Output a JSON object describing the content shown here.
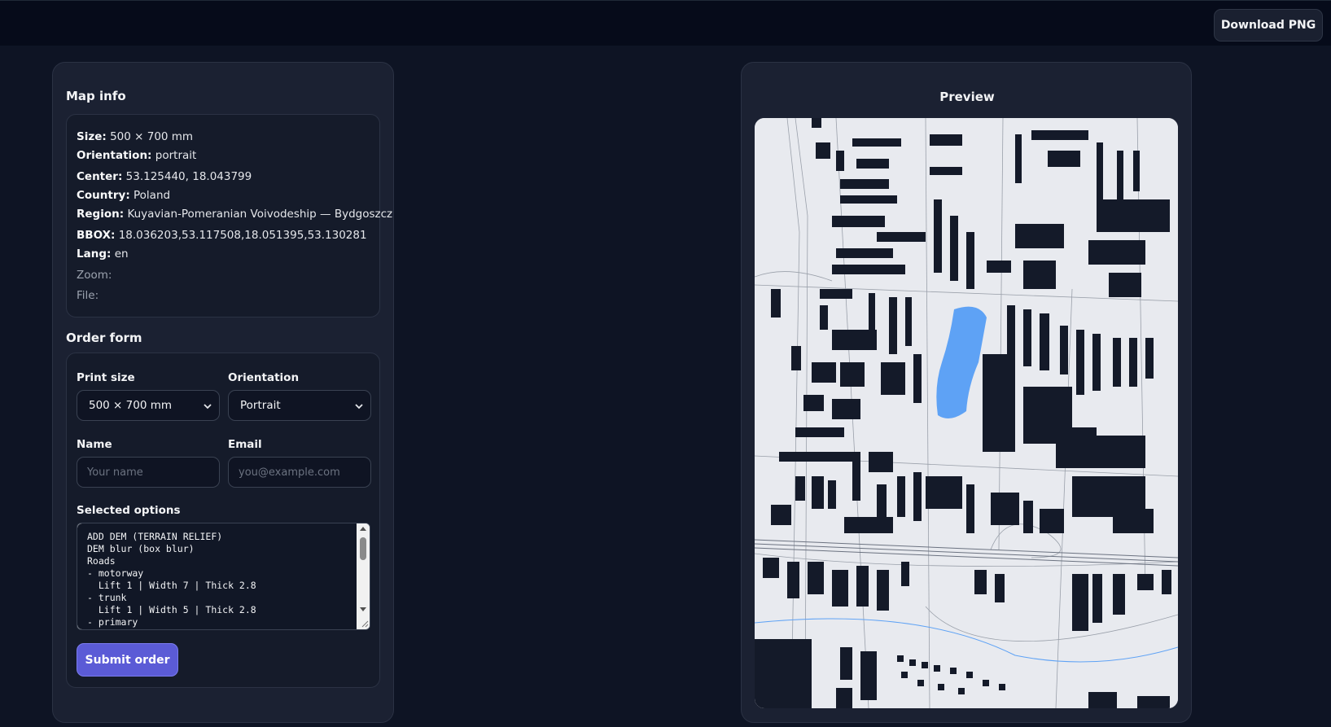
{
  "toolbar": {
    "download_label": "Download PNG"
  },
  "map_info": {
    "title": "Map info",
    "size_label": "Size:",
    "size_value": "500 × 700 mm",
    "orientation_label": "Orientation:",
    "orientation_value": "portrait",
    "center_label": "Center:",
    "center_value": "53.125440, 18.043799",
    "country_label": "Country:",
    "country_value": "Poland",
    "region_label": "Region:",
    "region_value": "Kuyavian-Pomeranian Voivodeship — Bydgoszcz",
    "bbox_label": "BBOX:",
    "bbox_value": "18.036203,53.117508,18.051395,53.130281",
    "lang_label": "Lang:",
    "lang_value": "en",
    "zoom_label": "Zoom:",
    "file_label": "File:"
  },
  "order_form": {
    "title": "Order form",
    "print_size_label": "Print size",
    "print_size_value": "500 × 700 mm",
    "orientation_label": "Orientation",
    "orientation_value": "Portrait",
    "name_label": "Name",
    "name_placeholder": "Your name",
    "email_label": "Email",
    "email_placeholder": "you@example.com",
    "options_label": "Selected options",
    "options_text": "ADD DEM (TERRAIN RELIEF)\nDEM blur (box blur)\nRoads\n- motorway\n  Lift 1 | Width 7 | Thick 2.8\n- trunk\n  Lift 1 | Width 5 | Thick 2.8\n- primary",
    "submit_label": "Submit order"
  },
  "preview": {
    "title": "Preview"
  },
  "colors": {
    "map_background": "#e8eaef",
    "building": "#141a29",
    "water": "#5ea2f5",
    "road_line": "#9aa0aa",
    "accent": "#5b5bd6"
  }
}
